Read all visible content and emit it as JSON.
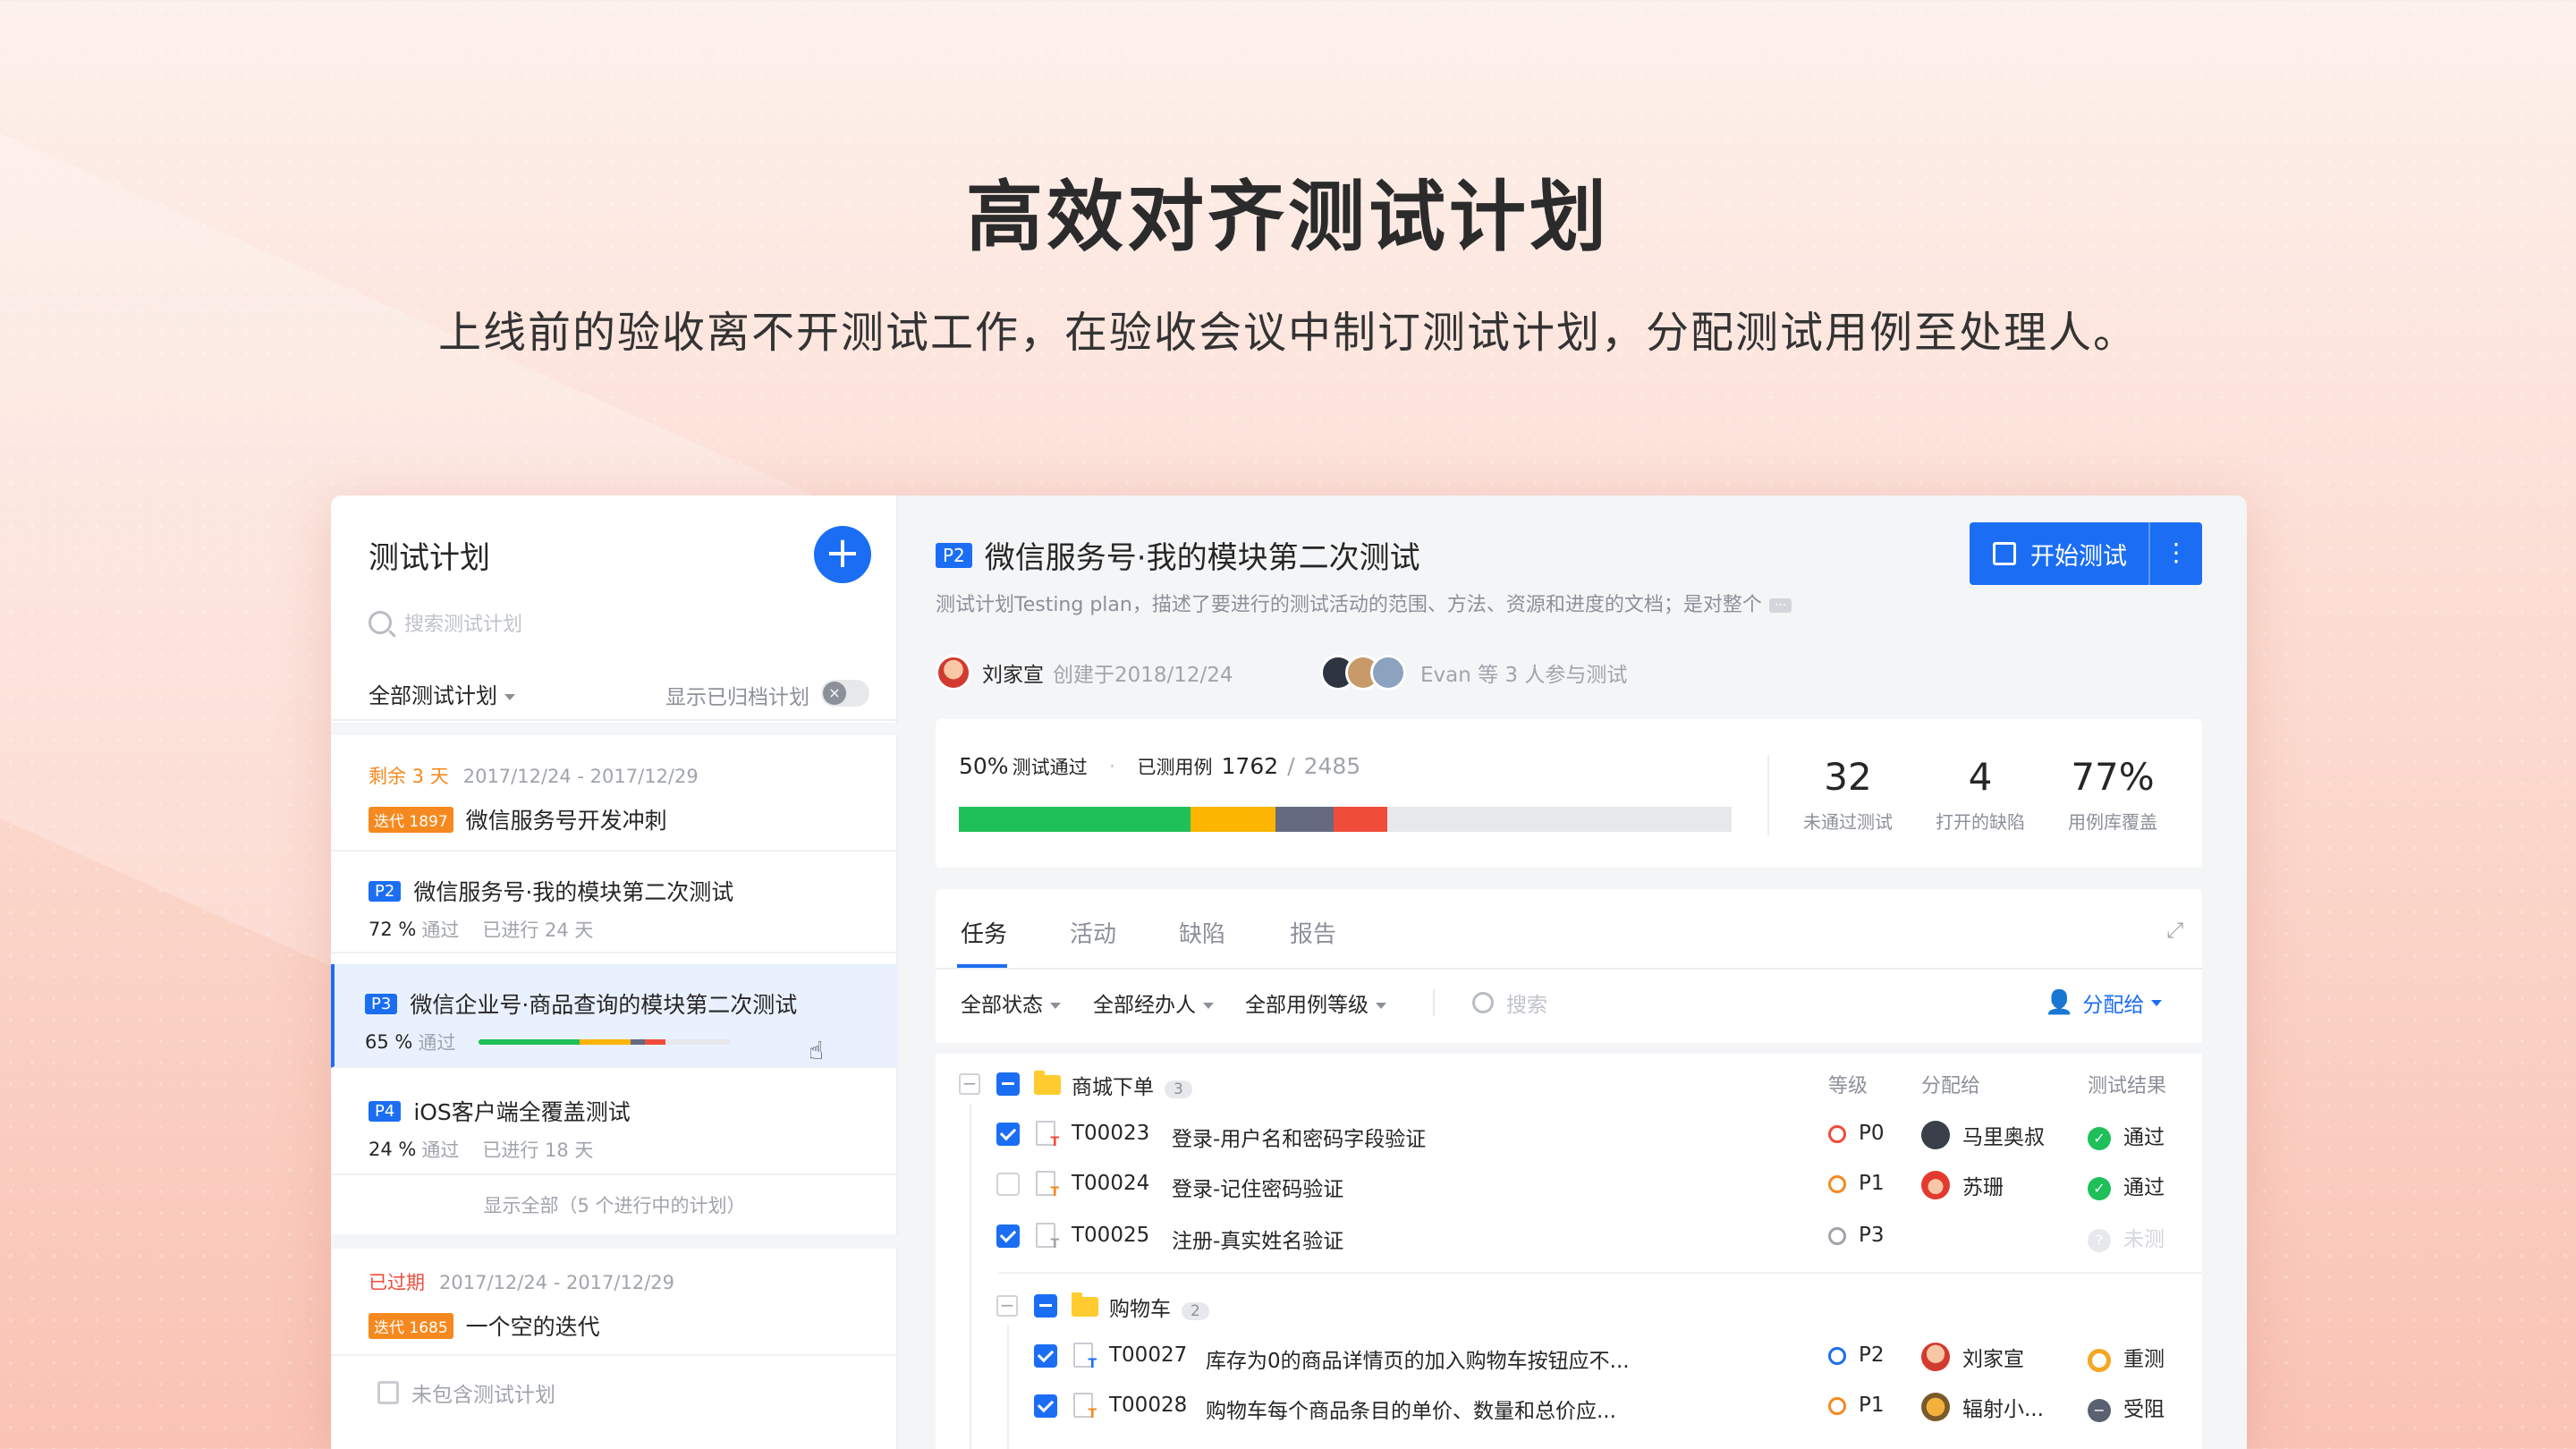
{
  "hero": {
    "title": "高效对齐测试计划",
    "subtitle": "上线前的验收离不开测试工作，在验收会议中制订测试计划，分配测试用例至处理人。"
  },
  "left": {
    "title": "测试计划",
    "add_icon": "plus-icon",
    "search_placeholder": "搜索测试计划",
    "filter_label": "全部测试计划",
    "archived_toggle_label": "显示已归档计划",
    "iteration1": {
      "remaining": "剩余 3 天",
      "dates": "2017/12/24 - 2017/12/29",
      "tag": "迭代 1897",
      "name": "微信服务号开发冲刺"
    },
    "plans": [
      {
        "tag": "P2",
        "name": "微信服务号·我的模块第二次测试",
        "pct": "72 %",
        "pass_label": "通过",
        "ago": "已进行 24 天"
      },
      {
        "tag": "P3",
        "name": "微信企业号·商品查询的模块第二次测试",
        "pct": "65 %",
        "pass_label": "通过",
        "progress": {
          "pass": 0.4,
          "warn": 0.2,
          "block": 0.06,
          "fail": 0.08
        }
      },
      {
        "tag": "P4",
        "name": "iOS客户端全覆盖测试",
        "pct": "24 %",
        "pass_label": "通过",
        "ago": "已进行 18 天"
      }
    ],
    "show_all": "显示全部（5 个进行中的计划）",
    "iteration2": {
      "status": "已过期",
      "dates": "2017/12/24 - 2017/12/29",
      "tag": "迭代 1685",
      "name": "一个空的迭代"
    },
    "no_plan": "未包含测试计划"
  },
  "detail": {
    "tag": "P2",
    "title": "微信服务号·我的模块第二次测试",
    "start_button": "开始测试",
    "more_icon": "more-vertical-icon",
    "description": "测试计划Testing plan，描述了要进行的测试活动的范围、方法、资源和进度的文档；是对整个",
    "desc_more": "···",
    "owner": "刘家宣",
    "created": "创建于2018/12/24",
    "participants": "Evan 等 3 人参与测试",
    "stats": {
      "pass_pct": "50%",
      "pass_label": "测试通过",
      "tested_label": "已测用例",
      "tested": "1762",
      "total": "2485",
      "bar": {
        "pass": 0.3,
        "warn": 0.11,
        "block": 0.075,
        "fail": 0.07
      },
      "kpis": [
        {
          "value": "32",
          "label": "未通过测试"
        },
        {
          "value": "4",
          "label": "打开的缺陷"
        },
        {
          "value": "77%",
          "label": "用例库覆盖"
        }
      ]
    },
    "tabs": [
      "任务",
      "活动",
      "缺陷",
      "报告"
    ],
    "filters": [
      "全部状态",
      "全部经办人",
      "全部用例等级"
    ],
    "search_placeholder": "搜索",
    "assign_label": "分配给",
    "columns": {
      "level": "等级",
      "assignee": "分配给",
      "result": "测试结果"
    },
    "groups": [
      {
        "name": "商城下单",
        "count": "3",
        "cases": [
          {
            "id": "T00023",
            "title": "登录-用户名和密码字段验证",
            "level": "P0",
            "level_color": "#f04c3a",
            "assignee": "马里奥叔",
            "result": "通过",
            "result_color": "#1fbf5a",
            "checked": true,
            "mark_color": "#f04c3a"
          },
          {
            "id": "T00024",
            "title": "登录-记住密码验证",
            "level": "P1",
            "level_color": "#f5891f",
            "assignee": "苏珊",
            "result": "通过",
            "result_color": "#1fbf5a",
            "checked": false,
            "mark_color": "#f5891f"
          },
          {
            "id": "T00025",
            "title": "注册-真实姓名验证",
            "level": "P3",
            "level_color": "#a0a4ab",
            "assignee": "",
            "result": "未测",
            "result_color": "#d3d6db",
            "checked": true,
            "mark_color": "#a0a4ab"
          }
        ]
      },
      {
        "name": "购物车",
        "count": "2",
        "cases": [
          {
            "id": "T00027",
            "title": "库存为0的商品详情页的加入购物车按钮应不...",
            "level": "P2",
            "level_color": "#1b6ef3",
            "assignee": "刘家宣",
            "result": "重测",
            "result_color": "#f5a623",
            "checked": true,
            "mark_color": "#1b6ef3"
          },
          {
            "id": "T00028",
            "title": "购物车每个商品条目的单价、数量和总价应...",
            "level": "P1",
            "level_color": "#f5891f",
            "assignee": "辐射小...",
            "result": "受阻",
            "result_color": "#5a6170",
            "checked": true,
            "mark_color": "#f5891f"
          }
        ]
      }
    ]
  },
  "colors": {
    "accent": "#1b6ef3",
    "pass": "#1fbf5a",
    "warn": "#fcb500",
    "block": "#656a80",
    "fail": "#f04c3a",
    "iteration": "#f5891f"
  }
}
